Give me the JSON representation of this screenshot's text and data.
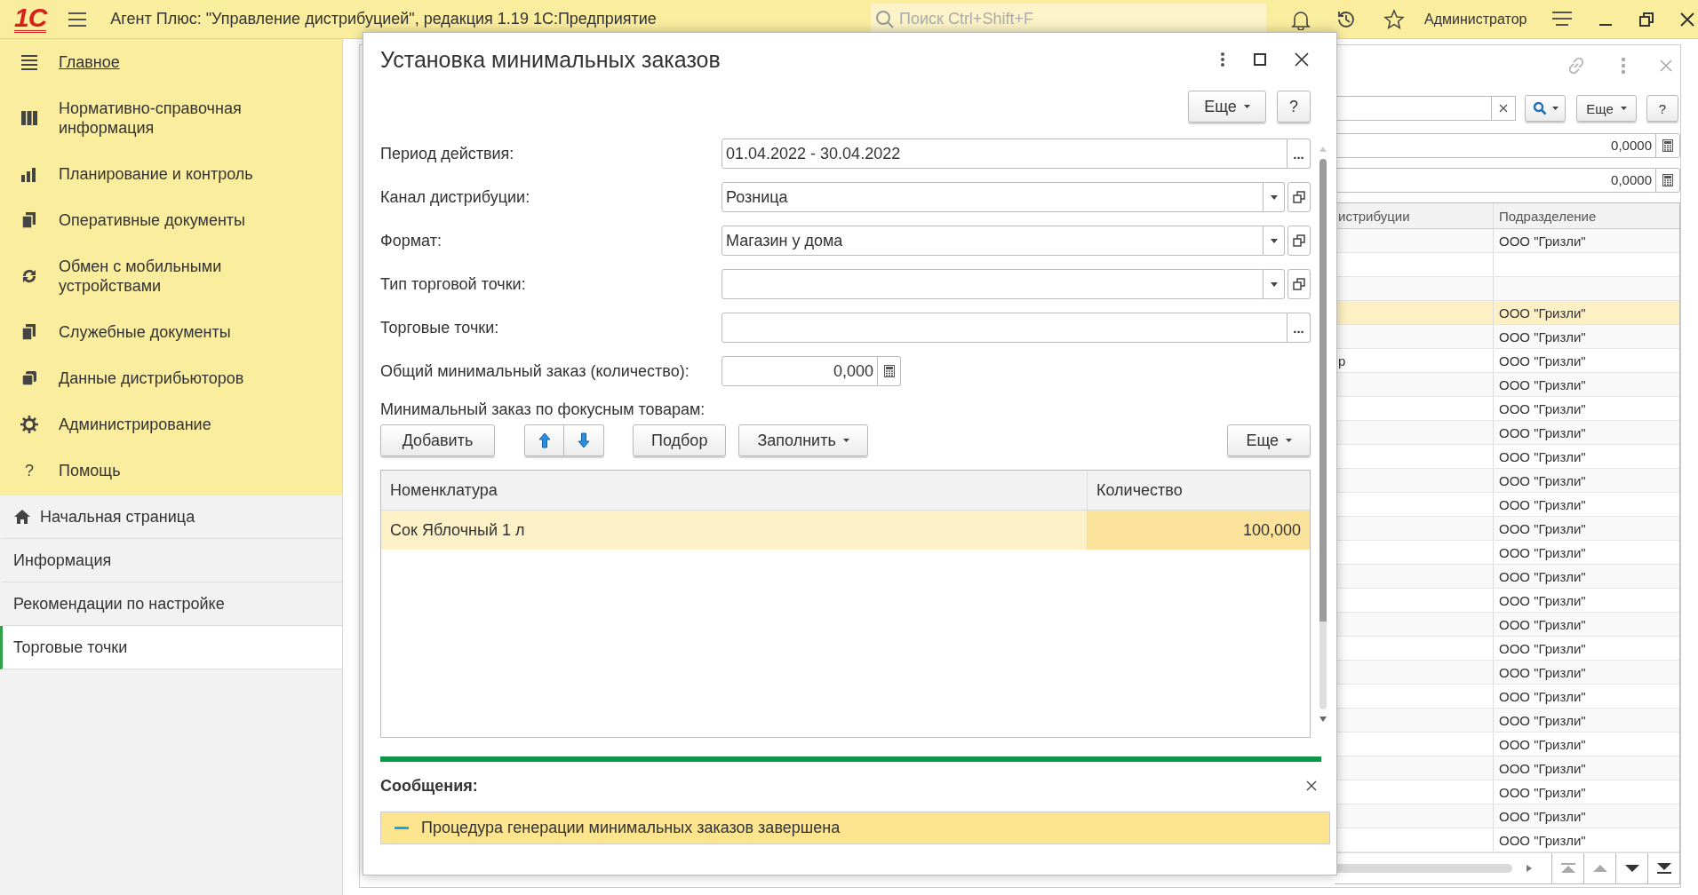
{
  "app_bar": {
    "logo": "1С",
    "title": "Агент Плюс: \"Управление дистрибуцией\", редакция 1.19 1С:Предприятие",
    "search": {
      "placeholder": "Поиск Ctrl+Shift+F"
    },
    "user": "Администратор"
  },
  "sidebar": {
    "sections": [
      {
        "label": "Главное",
        "selected": true
      },
      {
        "label": "Нормативно-справочная информация",
        "selected": false
      },
      {
        "label": "Планирование и контроль",
        "selected": false
      },
      {
        "label": "Оперативные документы",
        "selected": false
      },
      {
        "label": "Обмен с мобильными устройствами",
        "selected": false
      },
      {
        "label": "Служебные документы",
        "selected": false
      },
      {
        "label": "Данные дистрибьюторов",
        "selected": false
      },
      {
        "label": "Администрирование",
        "selected": false
      },
      {
        "label": "Помощь",
        "glyph": "?",
        "selected": false
      }
    ],
    "pages": [
      {
        "label": "Начальная страница",
        "kind": "home",
        "selected": false
      },
      {
        "label": "Информация",
        "kind": "plain",
        "selected": false
      },
      {
        "label": "Рекомендации по настройке",
        "kind": "plain",
        "selected": false
      },
      {
        "label": "Торговые точки",
        "kind": "plain",
        "selected": true
      }
    ]
  },
  "background_form": {
    "buttons": [
      "Еще",
      "?"
    ],
    "number_fields": [
      "0,0000",
      "0,0000"
    ],
    "table": {
      "columns": [
        "истрибуции",
        "Подразделение"
      ],
      "rows": [
        {
          "subdivision": "ООО \"Гризли\"",
          "selected": false
        },
        {
          "selected": false
        },
        {
          "selected": false
        },
        {
          "subdivision": "ООО \"Гризли\"",
          "selected": true
        },
        {
          "subdivision": "ООО \"Гризли\"",
          "selected": false
        },
        {
          "column_1": "р",
          "subdivision": "ООО \"Гризли\"",
          "selected": false
        },
        {
          "subdivision": "ООО \"Гризли\"",
          "selected": false
        },
        {
          "subdivision": "ООО \"Гризли\"",
          "selected": false
        },
        {
          "subdivision": "ООО \"Гризли\"",
          "selected": false
        },
        {
          "subdivision": "ООО \"Гризли\"",
          "selected": false
        },
        {
          "subdivision": "ООО \"Гризли\"",
          "selected": false
        },
        {
          "subdivision": "ООО \"Гризли\"",
          "selected": false
        },
        {
          "subdivision": "ООО \"Гризли\"",
          "selected": false
        },
        {
          "subdivision": "ООО \"Гризли\"",
          "selected": false
        },
        {
          "subdivision": "ООО \"Гризли\"",
          "selected": false
        },
        {
          "subdivision": "ООО \"Гризли\"",
          "selected": false
        },
        {
          "subdivision": "ООО \"Гризли\"",
          "selected": false
        },
        {
          "subdivision": "ООО \"Гризли\"",
          "selected": false
        },
        {
          "subdivision": "ООО \"Гризли\"",
          "selected": false
        },
        {
          "subdivision": "ООО \"Гризли\"",
          "selected": false
        },
        {
          "subdivision": "ООО \"Гризли\"",
          "selected": false
        },
        {
          "subdivision": "ООО \"Гризли\"",
          "selected": false
        },
        {
          "subdivision": "ООО \"Гризли\"",
          "selected": false
        },
        {
          "subdivision": "ООО \"Гризли\"",
          "selected": false
        },
        {
          "subdivision": "ООО \"Гризли\"",
          "selected": false
        },
        {
          "subdivision": "ООО \"Гризли\"",
          "selected": false
        }
      ]
    }
  },
  "dialog": {
    "title": "Установка минимальных заказов",
    "buttons": [
      "Еще",
      "?"
    ],
    "fields": [
      {
        "label": "Период действия:",
        "kind": "choice",
        "value": "01.04.2022 - 30.04.2022",
        "button": "..."
      },
      {
        "label": "Канал дистрибуции:",
        "kind": "select",
        "value": "Розница"
      },
      {
        "label": "Формат:",
        "kind": "select",
        "value": "Магазин у дома"
      },
      {
        "label": "Тип торговой точки:",
        "kind": "select"
      },
      {
        "label": "Торговые точки:",
        "kind": "choice",
        "button": "..."
      },
      {
        "label": "Общий минимальный заказ (количество):",
        "kind": "number",
        "value": "0,000"
      }
    ],
    "section_label": "Минимальный заказ по фокусным товарам:",
    "toolbar": [
      {
        "kind": "button",
        "label": "Добавить"
      },
      {
        "kind": "move_up"
      },
      {
        "kind": "move_down"
      },
      {
        "kind": "button",
        "label": "Подбор"
      },
      {
        "kind": "menu",
        "label": "Заполнить"
      },
      {
        "kind": "spacer"
      },
      {
        "kind": "menu",
        "label": "Еще"
      }
    ],
    "table": {
      "columns": [
        "Номенклатура",
        "Количество"
      ],
      "rows": [
        {
          "item": "Сок Яблочный 1 л",
          "quantity": "100,000",
          "selected": true
        }
      ]
    },
    "messages": {
      "title": "Сообщения:",
      "items": [
        "Процедура генерации минимальных заказов завершена"
      ]
    }
  }
}
